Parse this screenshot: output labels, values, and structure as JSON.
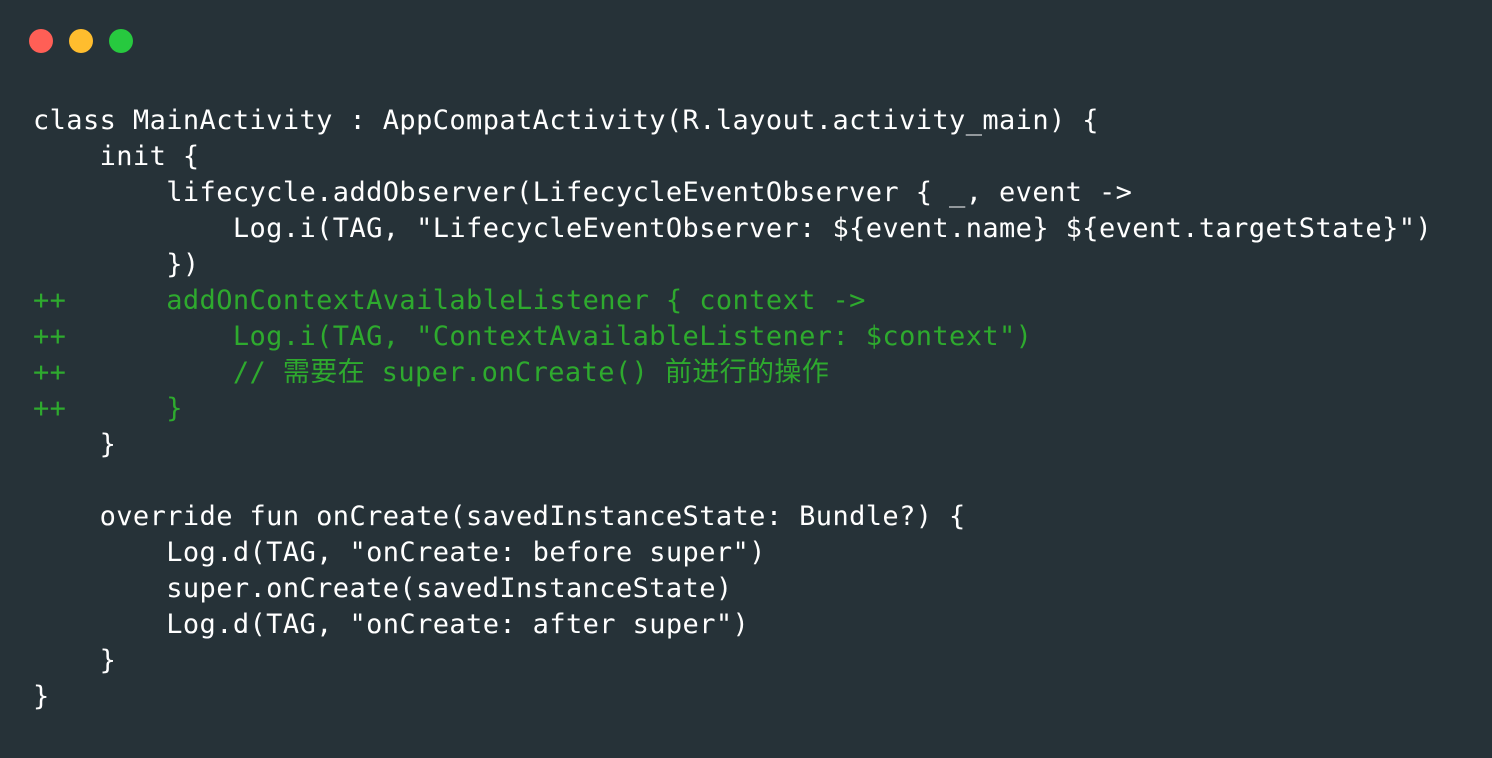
{
  "colors": {
    "background": "#263238",
    "text": "#ffffff",
    "added_text": "#2eaa2e",
    "close": "#ff5f56",
    "minimize": "#ffbd2e",
    "maximize": "#27c93f"
  },
  "traffic_lights": [
    {
      "name": "close-button",
      "color": "#ff5f56"
    },
    {
      "name": "minimize-button",
      "color": "#ffbd2e"
    },
    {
      "name": "maximize-button",
      "color": "#27c93f"
    }
  ],
  "code_lines": [
    {
      "text": "class MainActivity : AppCompatActivity(R.layout.activity_main) {",
      "kind": "normal"
    },
    {
      "text": "    init {",
      "kind": "normal"
    },
    {
      "text": "        lifecycle.addObserver(LifecycleEventObserver { _, event ->",
      "kind": "normal"
    },
    {
      "text": "            Log.i(TAG, \"LifecycleEventObserver: ${event.name} ${event.targetState}\")",
      "kind": "normal"
    },
    {
      "text": "        })",
      "kind": "normal"
    },
    {
      "text": "++      addOnContextAvailableListener { context ->",
      "kind": "added"
    },
    {
      "text": "++          Log.i(TAG, \"ContextAvailableListener: $context\")",
      "kind": "added"
    },
    {
      "text": "++          // 需要在 super.onCreate() 前进行的操作",
      "kind": "added"
    },
    {
      "text": "++      }",
      "kind": "added"
    },
    {
      "text": "    }",
      "kind": "normal"
    },
    {
      "text": "",
      "kind": "normal"
    },
    {
      "text": "    override fun onCreate(savedInstanceState: Bundle?) {",
      "kind": "normal"
    },
    {
      "text": "        Log.d(TAG, \"onCreate: before super\")",
      "kind": "normal"
    },
    {
      "text": "        super.onCreate(savedInstanceState)",
      "kind": "normal"
    },
    {
      "text": "        Log.d(TAG, \"onCreate: after super\")",
      "kind": "normal"
    },
    {
      "text": "    }",
      "kind": "normal"
    },
    {
      "text": "}",
      "kind": "normal"
    }
  ]
}
